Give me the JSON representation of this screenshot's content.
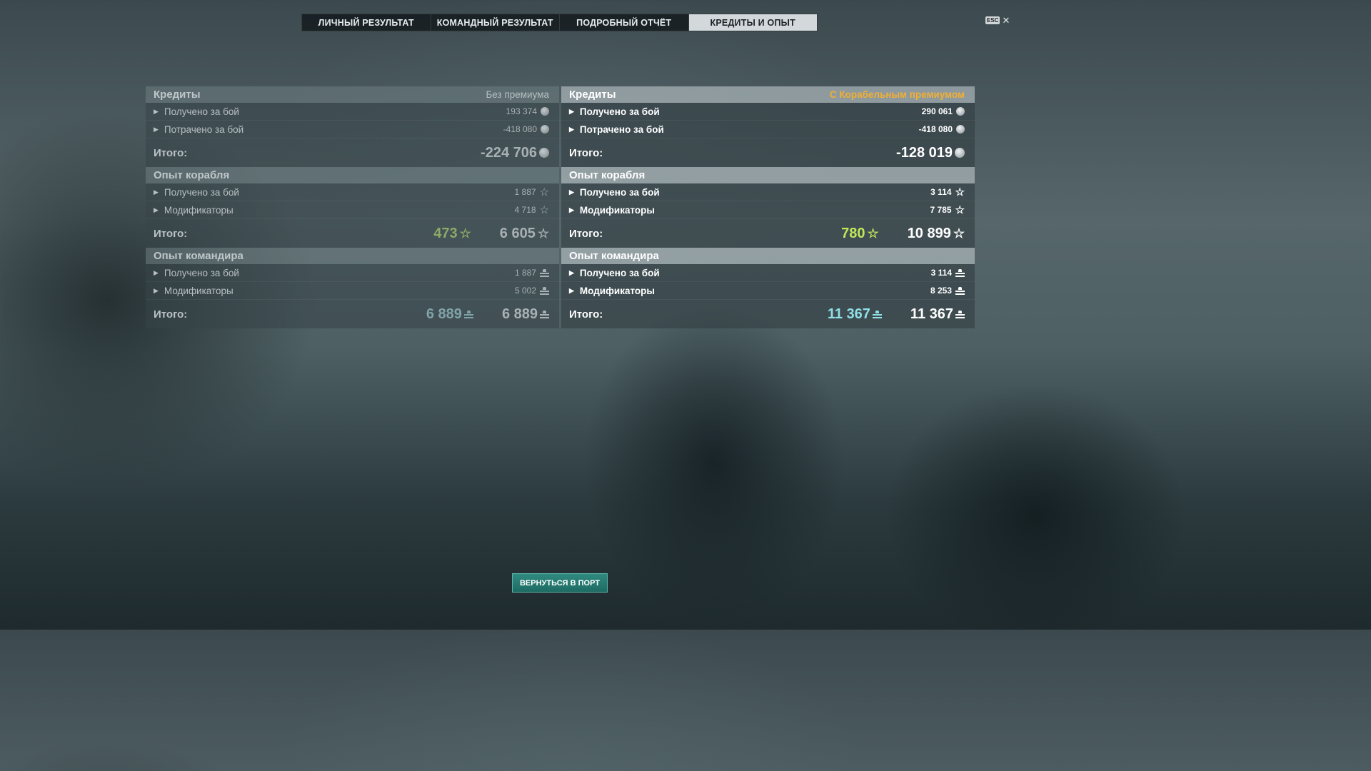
{
  "tabs": [
    "ЛИЧНЫЙ РЕЗУЛЬТАТ",
    "КОМАНДНЫЙ РЕЗУЛЬТАТ",
    "ПОДРОБНЫЙ ОТЧЁТ",
    "КРЕДИТЫ И ОПЫТ"
  ],
  "active_tab": "КРЕДИТЫ И ОПЫТ",
  "esc": {
    "key": "ESC",
    "close": "✕"
  },
  "left": {
    "credits": {
      "title": "Кредиты",
      "note": "Без премиума",
      "rows": [
        {
          "label": "Получено за бой",
          "value": "193 374"
        },
        {
          "label": "Потрачено за бой",
          "value": "-418 080"
        }
      ],
      "total_label": "Итого:",
      "total": "-224 706"
    },
    "ship_xp": {
      "title": "Опыт корабля",
      "rows": [
        {
          "label": "Получено за бой",
          "value": "1 887"
        },
        {
          "label": "Модификаторы",
          "value": "4 718"
        }
      ],
      "total_label": "Итого:",
      "total_base": "473",
      "total": "6 605"
    },
    "commander_xp": {
      "title": "Опыт командира",
      "rows": [
        {
          "label": "Получено за бой",
          "value": "1 887"
        },
        {
          "label": "Модификаторы",
          "value": "5 002"
        }
      ],
      "total_label": "Итого:",
      "total_base": "6 889",
      "total": "6 889"
    }
  },
  "right": {
    "credits": {
      "title": "Кредиты",
      "note": "С Корабельным премиумом",
      "rows": [
        {
          "label": "Получено за бой",
          "value": "290 061"
        },
        {
          "label": "Потрачено за бой",
          "value": "-418 080"
        }
      ],
      "total_label": "Итого:",
      "total": "-128 019"
    },
    "ship_xp": {
      "title": "Опыт корабля",
      "rows": [
        {
          "label": "Получено за бой",
          "value": "3 114"
        },
        {
          "label": "Модификаторы",
          "value": "7 785"
        }
      ],
      "total_label": "Итого:",
      "total_base": "780",
      "total": "10 899"
    },
    "commander_xp": {
      "title": "Опыт командира",
      "rows": [
        {
          "label": "Получено за бой",
          "value": "3 114"
        },
        {
          "label": "Модификаторы",
          "value": "8 253"
        }
      ],
      "total_label": "Итого:",
      "total_base": "11 367",
      "total": "11 367"
    }
  },
  "icons": {
    "credits": "credit-coin-icon",
    "ship_xp": "star-icon",
    "commander_xp": "commander-xp-icon",
    "expand": "chevron-right-icon"
  },
  "colors": {
    "premium_note": "#f2b033",
    "ship_xp_base": "#bfe85a",
    "commander_xp_base": "#8fe0e8",
    "return_button": "#1e6b63"
  },
  "return_button": "ВЕРНУТЬСЯ В ПОРТ"
}
